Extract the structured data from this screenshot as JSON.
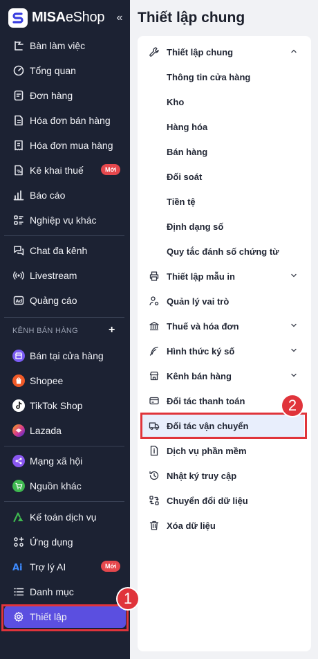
{
  "app": {
    "logo_bold": "MISA",
    "logo_light": "eShop",
    "collapse_icon": "double-chevron-left-icon"
  },
  "sidebar": {
    "items": [
      {
        "label": "Bàn làm việc",
        "icon": "desk-icon"
      },
      {
        "label": "Tổng quan",
        "icon": "dashboard-icon"
      },
      {
        "label": "Đơn hàng",
        "icon": "order-icon"
      },
      {
        "label": "Hóa đơn bán hàng",
        "icon": "sales-invoice-icon"
      },
      {
        "label": "Hóa đơn mua hàng",
        "icon": "purchase-invoice-icon"
      },
      {
        "label": "Kê khai thuế",
        "icon": "tax-icon",
        "badge": "Mới"
      },
      {
        "label": "Báo cáo",
        "icon": "report-icon"
      },
      {
        "label": "Nghiệp vụ khác",
        "icon": "other-ops-icon"
      },
      {
        "label": "Chat đa kênh",
        "icon": "chat-icon"
      },
      {
        "label": "Livestream",
        "icon": "livestream-icon"
      },
      {
        "label": "Quảng cáo",
        "icon": "ads-icon"
      }
    ],
    "channel_section": {
      "title": "KÊNH BÁN HÀNG",
      "items": [
        {
          "label": "Bán tại cửa hàng",
          "icon": "store-icon",
          "color": "#7b5cf5"
        },
        {
          "label": "Shopee",
          "icon": "shopee-icon",
          "color": "#f05a28"
        },
        {
          "label": "TikTok Shop",
          "icon": "tiktok-icon",
          "color": "#ffffff"
        },
        {
          "label": "Lazada",
          "icon": "lazada-icon",
          "color": "#d63a8c"
        }
      ]
    },
    "social_items": [
      {
        "label": "Mạng xã hội",
        "icon": "social-icon",
        "color": "#8a57f0"
      },
      {
        "label": "Nguồn khác",
        "icon": "cart-icon",
        "color": "#3fb950"
      }
    ],
    "bottom_items": [
      {
        "label": "Kế toán dịch vụ",
        "icon": "accounting-icon"
      },
      {
        "label": "Ứng dụng",
        "icon": "apps-icon"
      },
      {
        "label": "Trợ lý AI",
        "icon": "ai-icon",
        "badge": "Mới"
      },
      {
        "label": "Danh mục",
        "icon": "list-icon"
      },
      {
        "label": "Thiết lập",
        "icon": "gear-icon",
        "active": true
      }
    ]
  },
  "main": {
    "title": "Thiết lập chung",
    "menu": [
      {
        "label": "Thiết lập chung",
        "icon": "wrench-icon",
        "expanded": true,
        "children": [
          "Thông tin cửa hàng",
          "Kho",
          "Hàng hóa",
          "Bán hàng",
          "Đối soát",
          "Tiền tệ",
          "Định dạng số",
          "Quy tắc đánh số chứng từ"
        ]
      },
      {
        "label": "Thiết lập mẫu in",
        "icon": "printer-icon",
        "expandable": true
      },
      {
        "label": "Quản lý vai trò",
        "icon": "user-gear-icon"
      },
      {
        "label": "Thuế và hóa đơn",
        "icon": "bank-icon",
        "expandable": true
      },
      {
        "label": "Hình thức ký số",
        "icon": "feather-icon",
        "expandable": true
      },
      {
        "label": "Kênh bán hàng",
        "icon": "shop-icon",
        "expandable": true
      },
      {
        "label": "Đối tác thanh toán",
        "icon": "card-icon"
      },
      {
        "label": "Đối tác vận chuyển",
        "icon": "truck-icon",
        "selected": true
      },
      {
        "label": "Dịch vụ phần mềm",
        "icon": "document-info-icon"
      },
      {
        "label": "Nhật ký truy cập",
        "icon": "history-icon"
      },
      {
        "label": "Chuyển đổi dữ liệu",
        "icon": "convert-icon"
      },
      {
        "label": "Xóa dữ liệu",
        "icon": "trash-icon"
      }
    ]
  },
  "annotations": {
    "step1": "1",
    "step2": "2",
    "color": "#e0343b"
  },
  "colors": {
    "sidebar_bg": "#1c2233",
    "accent": "#5b4fe0",
    "badge": "#e5484d",
    "selected_bg": "#e8eefc"
  }
}
